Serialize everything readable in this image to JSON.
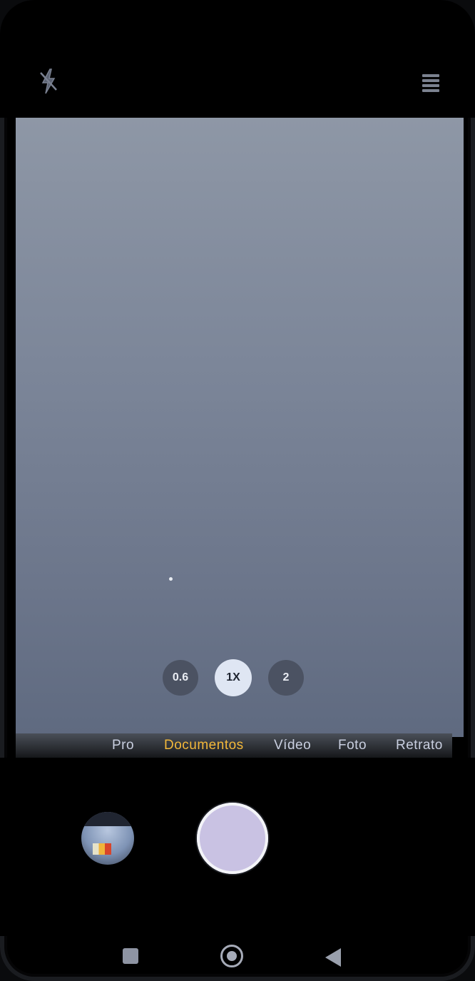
{
  "top_bar": {
    "flash_icon": "flash-off-icon",
    "menu_icon": "menu-icon"
  },
  "viewfinder": {
    "zoom_levels": [
      "0.6",
      "1X",
      "2"
    ],
    "active_zoom": "1X"
  },
  "mode_strip": {
    "items": [
      "Pro",
      "Documentos",
      "Vídeo",
      "Foto",
      "Retrato"
    ],
    "active": "Documentos",
    "active_color": "#f3b83a"
  },
  "bottom": {
    "thumbnail_icon": "gallery-thumbnail",
    "shutter_icon": "shutter-button"
  },
  "nav": {
    "recents_icon": "square-icon",
    "home_icon": "circle-icon",
    "back_icon": "triangle-back-icon"
  }
}
